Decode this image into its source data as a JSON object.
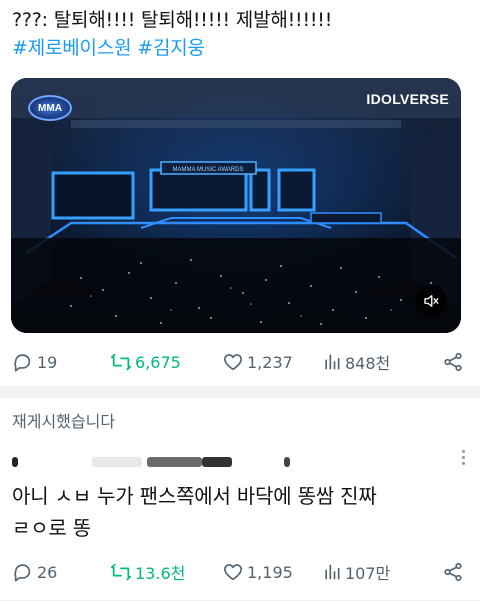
{
  "tweet": {
    "text_line1": "???: 탈퇴해!!!! 탈퇴해!!!!! 제발해!!!!!!",
    "hashtag1": "#제로베이스원",
    "hashtag2": "#김지웅",
    "media": {
      "logo": "MMA",
      "watermark": "IDOLVERSE",
      "stage_sign": "MAMMA MUSIC AWARDS",
      "mute_icon": "speaker-muted-icon"
    },
    "actions": {
      "replies": "19",
      "reposts": "6,675",
      "likes": "1,237",
      "views": "848천"
    }
  },
  "repost_label": "재게시했습니다",
  "reply": {
    "text_line1": "아니 ㅅㅂ 누가 팬스쪽에서 바닥에 똥쌈 진짜",
    "text_line2": "ㄹㅇ로 똥",
    "actions": {
      "replies": "26",
      "reposts": "13.6천",
      "likes": "1,195",
      "views": "107만"
    }
  },
  "colors": {
    "accent": "#1d9bf0",
    "repost": "#00ba7c",
    "muted": "#536471"
  }
}
